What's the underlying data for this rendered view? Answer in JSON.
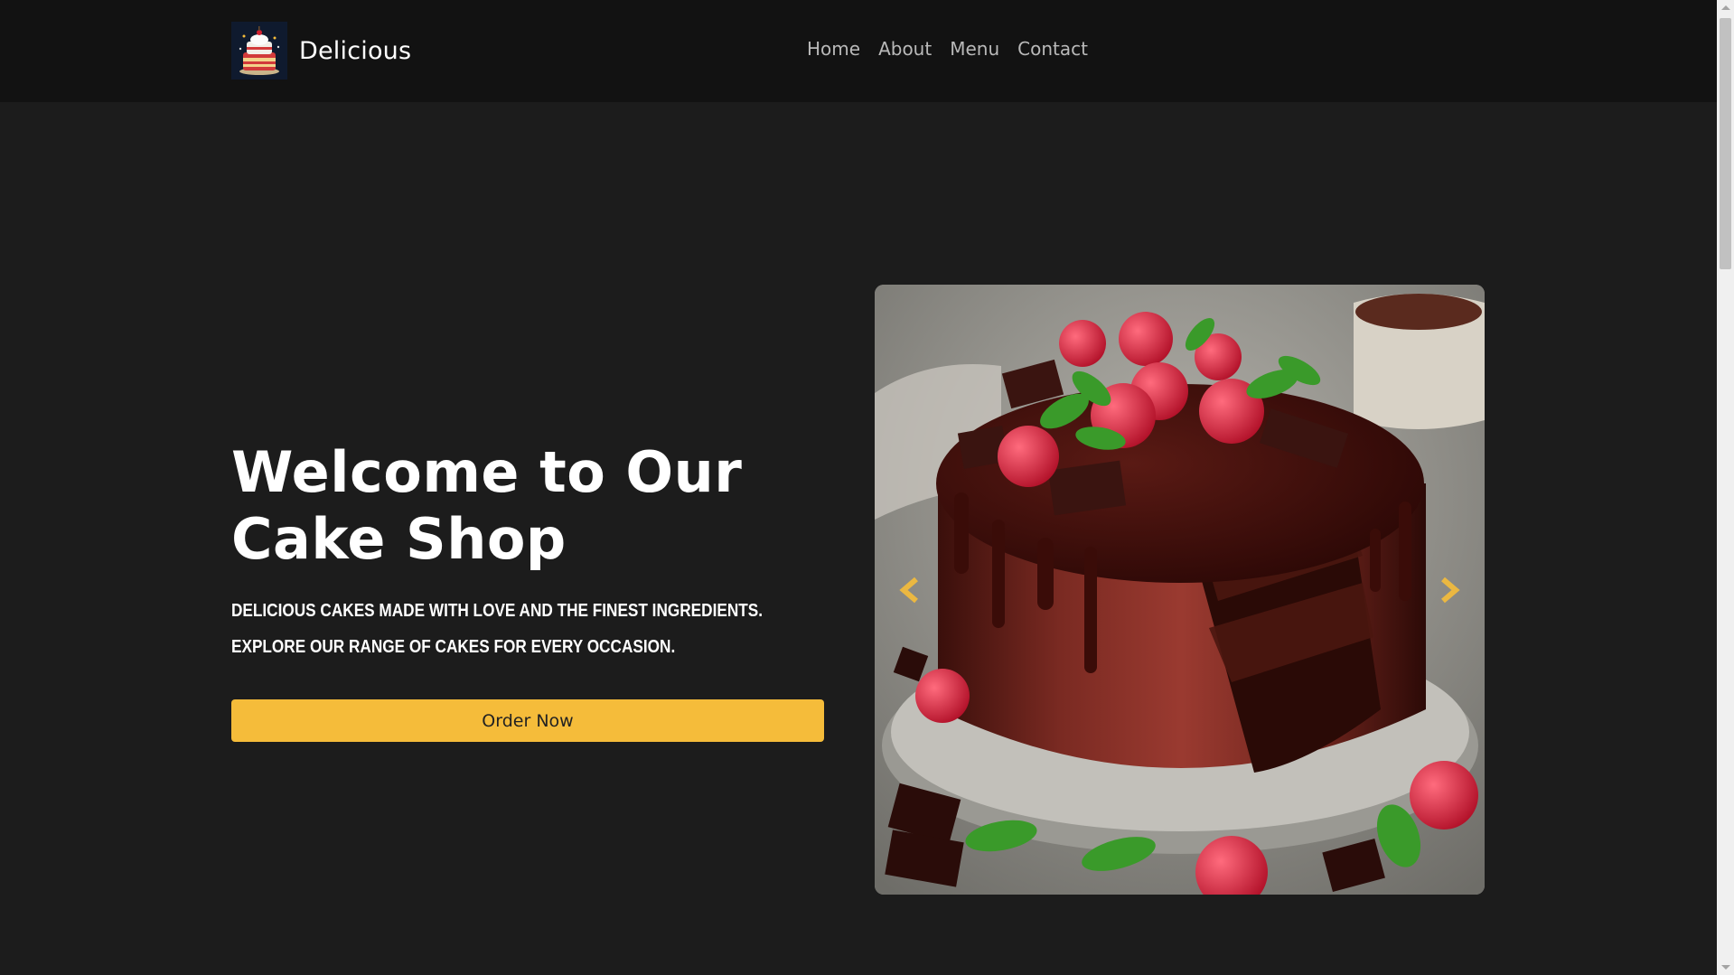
{
  "navbar": {
    "brand_name": "Delicious",
    "logo_icon": "cake-logo-icon",
    "links": [
      "Home",
      "About",
      "Menu",
      "Contact"
    ]
  },
  "hero": {
    "title": "Welcome to Our Cake Shop",
    "subtitle": "Delicious cakes made with love and the finest ingredients. Explore our range of cakes for every occasion.",
    "cta_label": "Order Now"
  },
  "carousel": {
    "image_icon": "chocolate-cake-image",
    "prev_icon": "chevron-left-icon",
    "next_icon": "chevron-right-icon"
  },
  "colors": {
    "page_bg": "#1c1c1c",
    "navbar_bg": "#121212",
    "accent": "#f5bc3a",
    "nav_link": "#b9b9b9"
  }
}
